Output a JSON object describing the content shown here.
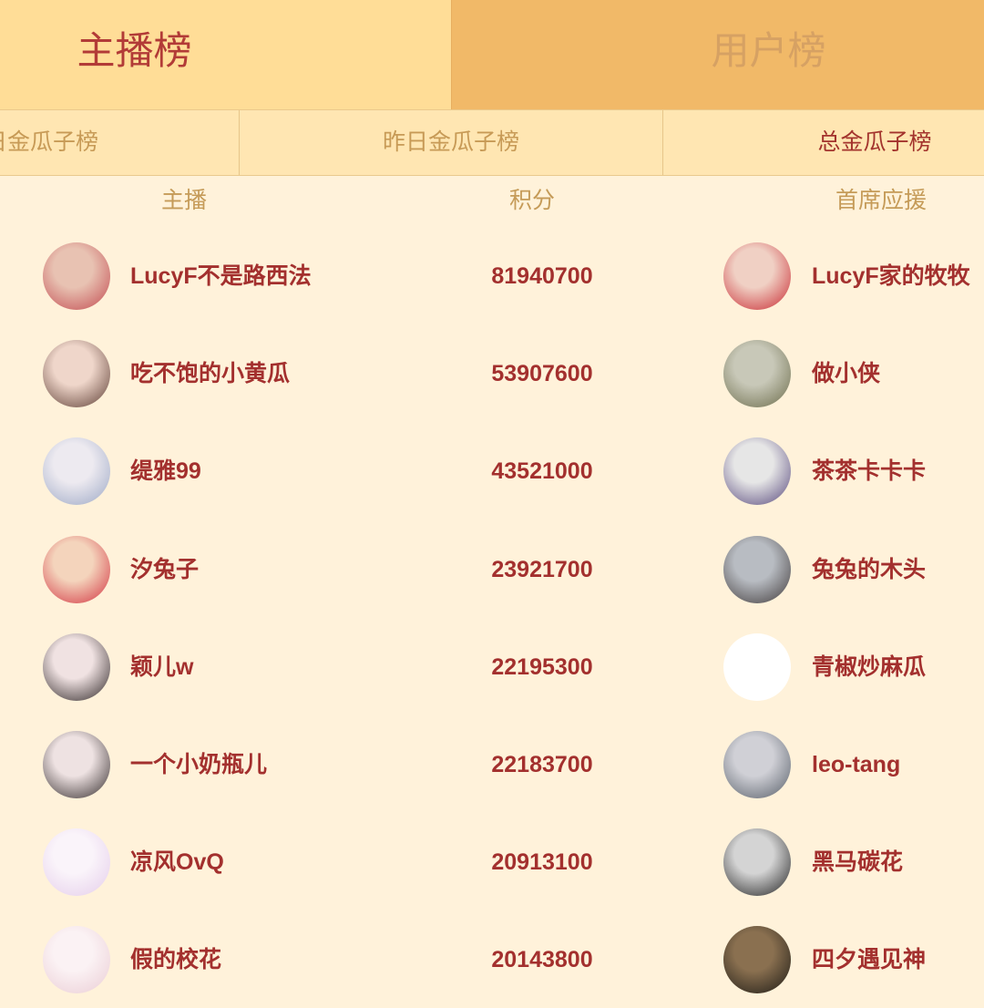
{
  "top_tabs": [
    {
      "label": "主播榜",
      "active": true
    },
    {
      "label": "用户榜",
      "active": false
    }
  ],
  "sub_tabs": [
    {
      "label": "日金瓜子榜",
      "active": false
    },
    {
      "label": "昨日金瓜子榜",
      "active": false
    },
    {
      "label": "总金瓜子榜",
      "active": true
    }
  ],
  "columns": {
    "streamer": "主播",
    "score": "积分",
    "top_supporter": "首席应援"
  },
  "rows": [
    {
      "streamer": {
        "name": "LucyF不是路西法",
        "avatar_colors": [
          "#E8C2B2",
          "#C2484E"
        ]
      },
      "score": "81940700",
      "supporter": {
        "name": "LucyF家的牧牧",
        "avatar_colors": [
          "#F0D0C4",
          "#C8262E"
        ]
      }
    },
    {
      "streamer": {
        "name": "吃不饱的小黄瓜",
        "avatar_colors": [
          "#EFD6CA",
          "#5A3A30"
        ]
      },
      "score": "53907600",
      "supporter": {
        "name": "做小侠",
        "avatar_colors": [
          "#C8C8B8",
          "#6A6A48"
        ]
      }
    },
    {
      "streamer": {
        "name": "缇雅99",
        "avatar_colors": [
          "#EDEAF0",
          "#9AA6C4"
        ]
      },
      "score": "43521000",
      "supporter": {
        "name": "茶茶卡卡卡",
        "avatar_colors": [
          "#E6E6E6",
          "#54447A"
        ]
      }
    },
    {
      "streamer": {
        "name": "汐兔子",
        "avatar_colors": [
          "#F4D4BC",
          "#D2303E"
        ]
      },
      "score": "23921700",
      "supporter": {
        "name": "兔兔的木头",
        "avatar_colors": [
          "#B8BCC2",
          "#3E3838"
        ]
      }
    },
    {
      "streamer": {
        "name": "颖儿w",
        "avatar_colors": [
          "#F0E2E2",
          "#2A2222"
        ]
      },
      "score": "22195300",
      "supporter": {
        "name": "青椒炒麻瓜",
        "avatar_colors": [
          "#FFFFFF",
          "#FFFFFF"
        ]
      }
    },
    {
      "streamer": {
        "name": "一个小奶瓶儿",
        "avatar_colors": [
          "#EEE2E2",
          "#302828"
        ]
      },
      "score": "22183700",
      "supporter": {
        "name": "leo-tang",
        "avatar_colors": [
          "#D0D0D6",
          "#545C66"
        ]
      }
    },
    {
      "streamer": {
        "name": "凉风OvQ",
        "avatar_colors": [
          "#FAF4FA",
          "#E4CCEA"
        ]
      },
      "score": "20913100",
      "supporter": {
        "name": "黑马碳花",
        "avatar_colors": [
          "#D4D4D4",
          "#1E1E1E"
        ]
      }
    },
    {
      "streamer": {
        "name": "假的校花",
        "avatar_colors": [
          "#FBF2F4",
          "#EACCD4"
        ]
      },
      "score": "20143800",
      "supporter": {
        "name": "四夕遇见神",
        "avatar_colors": [
          "#8A7050",
          "#1A1814"
        ]
      }
    }
  ],
  "colors": {
    "active_tab_bg": "#FFDD97",
    "inactive_tab_bg": "#F1B968",
    "accent_red": "#A3302E",
    "muted_gold": "#C79A56",
    "page_bg": "#FFF2DA"
  }
}
